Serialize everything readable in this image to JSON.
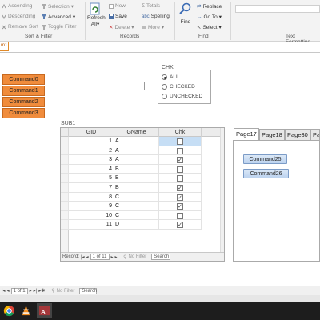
{
  "ribbon": {
    "sort_filter": {
      "ascending": "Ascending",
      "descending": "Descending",
      "remove_sort": "Remove Sort",
      "selection": "Selection",
      "advanced": "Advanced",
      "toggle_filter": "Toggle Filter",
      "group_label": "Sort & Filter"
    },
    "records": {
      "refresh_all": "Refresh",
      "refresh_all_2": "All",
      "new": "New",
      "save": "Save",
      "delete": "Delete",
      "totals": "Totals",
      "spelling": "Spelling",
      "more": "More",
      "group_label": "Records"
    },
    "find": {
      "find": "Find",
      "replace": "Replace",
      "go_to": "Go To",
      "select": "Select",
      "group_label": "Find"
    },
    "text_formatting": {
      "group_label": "Text Formatting"
    }
  },
  "doc_tab": {
    "label": "m1"
  },
  "commands": [
    "Command0",
    "Command1",
    "Command2",
    "Command3"
  ],
  "textbox": {
    "value": ""
  },
  "chk_group": {
    "title": "CHK",
    "options": [
      "ALL",
      "CHECKED",
      "UNCHECKED"
    ],
    "selected": "ALL"
  },
  "subform": {
    "label": "SUB1",
    "columns": [
      "GID",
      "GName",
      "Chk"
    ],
    "rows": [
      {
        "gid": "1",
        "gname": "A",
        "chk": false
      },
      {
        "gid": "2",
        "gname": "A",
        "chk": false
      },
      {
        "gid": "3",
        "gname": "A",
        "chk": true
      },
      {
        "gid": "4",
        "gname": "B",
        "chk": false
      },
      {
        "gid": "5",
        "gname": "B",
        "chk": false
      },
      {
        "gid": "7",
        "gname": "B",
        "chk": true
      },
      {
        "gid": "8",
        "gname": "C",
        "chk": true
      },
      {
        "gid": "9",
        "gname": "C",
        "chk": true
      },
      {
        "gid": "10",
        "gname": "C",
        "chk": false
      },
      {
        "gid": "11",
        "gname": "D",
        "chk": true
      }
    ],
    "nav": {
      "record_label": "Record:",
      "position": "1 of 11",
      "filter": "No Filter",
      "search": "Search"
    }
  },
  "tab_control": {
    "tabs": [
      "Page17",
      "Page18",
      "Page30",
      "Pa"
    ],
    "active_tab": "Page17",
    "buttons": [
      "Command25",
      "Command26"
    ]
  },
  "main_nav": {
    "position": "1 of 1",
    "filter": "No Filter",
    "search": "Search"
  },
  "colors": {
    "command_orange": "#f08c3c",
    "selection_blue": "#c6def5",
    "tab_button_blue": "#bcd3ef"
  },
  "taskbar": {
    "icons": [
      "chrome-icon",
      "vlc-icon",
      "access-icon"
    ]
  }
}
